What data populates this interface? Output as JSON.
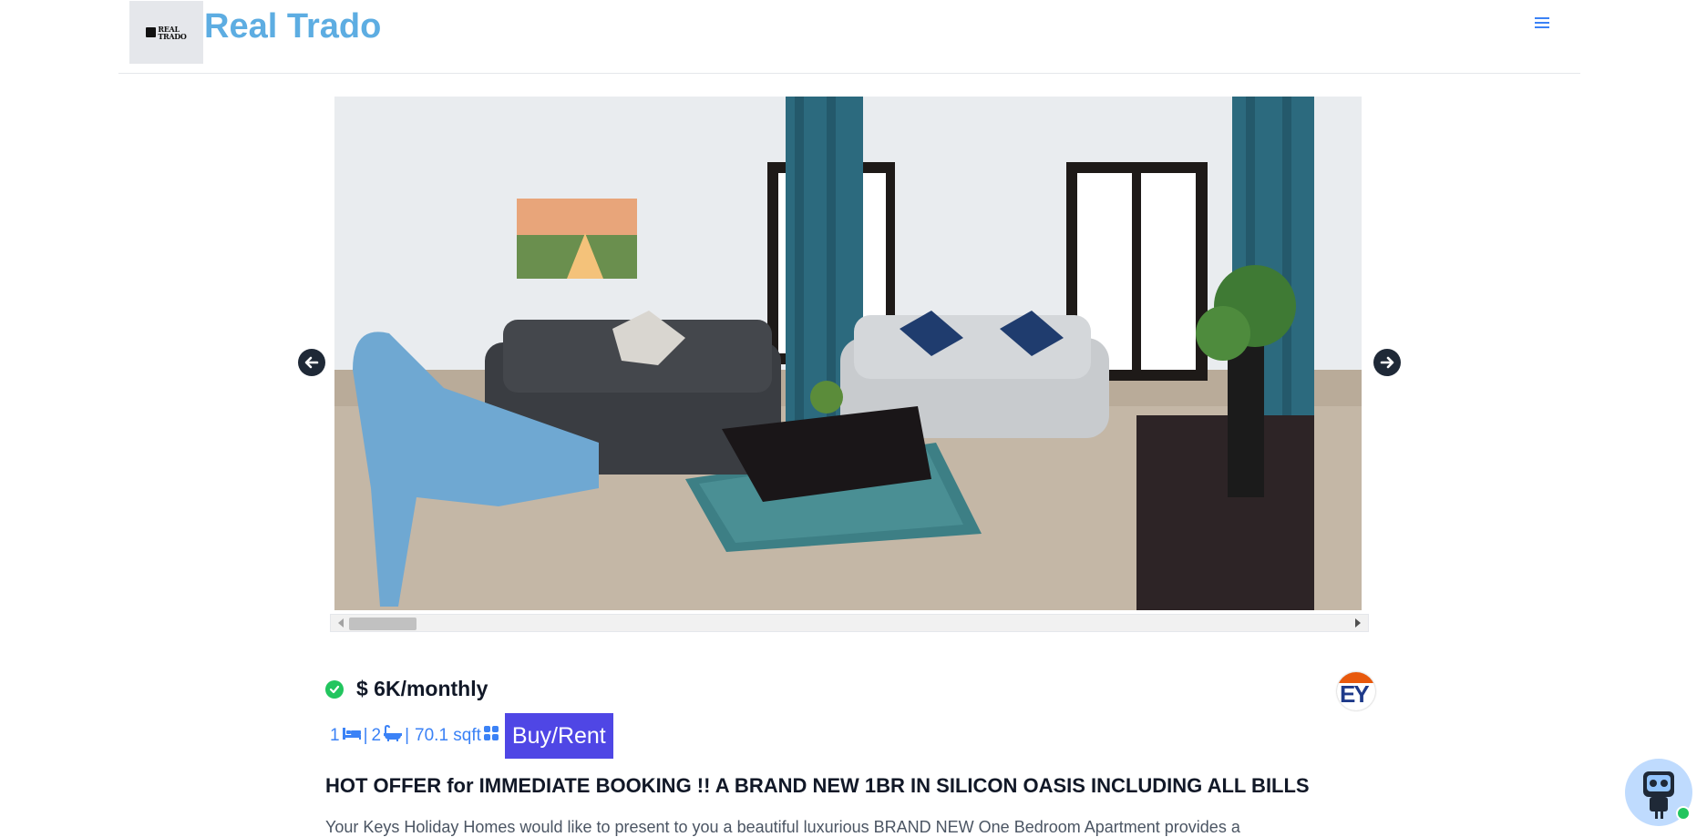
{
  "header": {
    "logo_text_line1": "REAL",
    "logo_text_line2": "TRADO",
    "brand": "Real Trado",
    "menu_icon": "hamburger-menu-icon"
  },
  "carousel": {
    "prev_icon": "arrow-left-icon",
    "next_icon": "arrow-right-icon",
    "image_alt": "Living room photo"
  },
  "listing": {
    "verified_icon": "check-circle-icon",
    "price": "$ 6K/monthly",
    "agency_logo_text": "EY",
    "specs": {
      "bedrooms": "1",
      "bathrooms": "2",
      "area": "70.1 sqft",
      "sep": "|"
    },
    "action_button": "Buy/Rent",
    "title": "HOT OFFER for IMMEDIATE BOOKING !! A BRAND NEW 1BR IN SILICON OASIS INCLUDING ALL BILLS",
    "description": "Your Keys Holiday Homes would like to present to you a beautiful luxurious BRAND NEW One Bedroom Apartment provides a"
  },
  "chat": {
    "icon": "robot-assistant-icon",
    "status": "online"
  },
  "colors": {
    "brand": "#5dade2",
    "accent": "#3b82f6",
    "button": "#4f46e5",
    "verified": "#22c55e"
  }
}
